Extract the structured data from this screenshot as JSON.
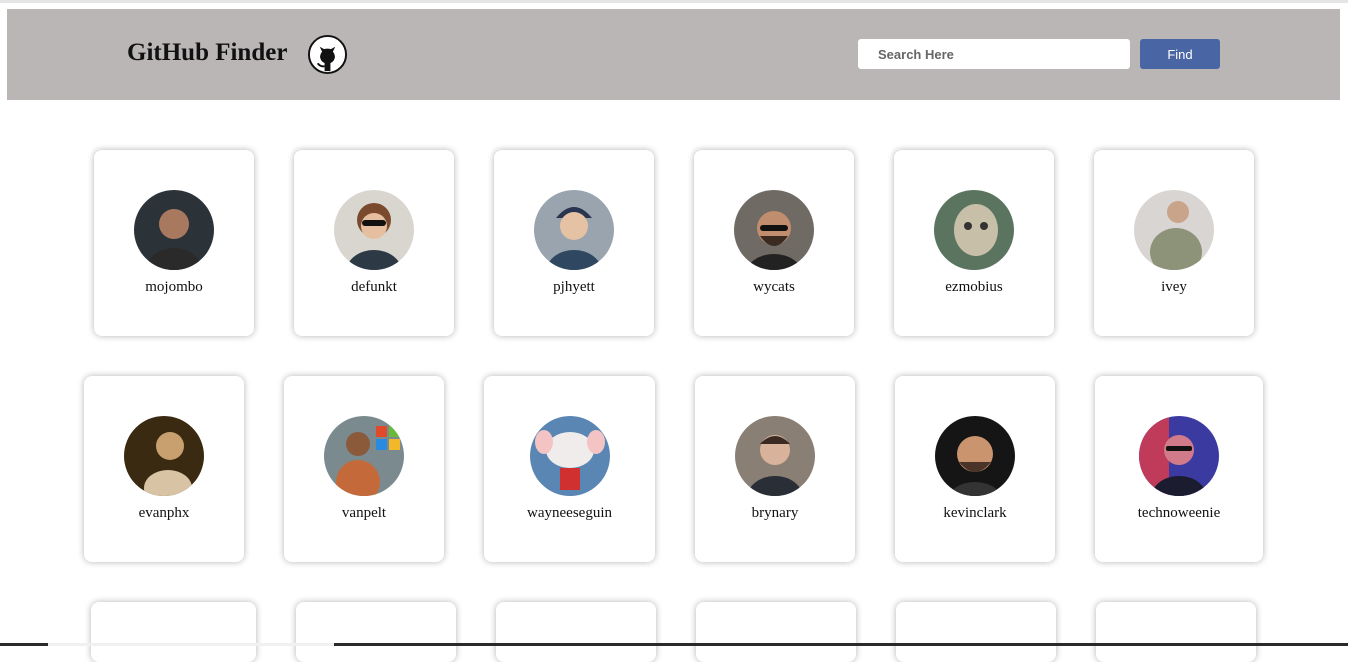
{
  "header": {
    "title": "GitHub Finder",
    "search_placeholder": "Search Here",
    "search_value": "",
    "find_label": "Find"
  },
  "users": [
    {
      "login": "mojombo",
      "bg": "#2b3238",
      "fg": "#a8795f"
    },
    {
      "login": "defunkt",
      "bg": "#d9d6cf",
      "fg": "#7a4a2e"
    },
    {
      "login": "pjhyett",
      "bg": "#9aa4ae",
      "fg": "#e5c2a4"
    },
    {
      "login": "wycats",
      "bg": "#6f6a63",
      "fg": "#c08e6f"
    },
    {
      "login": "ezmobius",
      "bg": "#5a7460",
      "fg": "#c7bfa8"
    },
    {
      "login": "ivey",
      "bg": "#d8d5d2",
      "fg": "#8c9378"
    },
    {
      "login": "evanphx",
      "bg": "#3a2a12",
      "fg": "#c8a070"
    },
    {
      "login": "vanpelt",
      "bg": "#7a8a8e",
      "fg": "#c46a3a"
    },
    {
      "login": "wayneeseguin",
      "bg": "#5a86b4",
      "fg": "#f1ecec"
    },
    {
      "login": "brynary",
      "bg": "#8a7f74",
      "fg": "#d8b29a"
    },
    {
      "login": "kevinclark",
      "bg": "#151515",
      "fg": "#c9946e"
    },
    {
      "login": "technoweenie",
      "bg": "#3a3aa0",
      "fg": "#d07a8a"
    }
  ]
}
